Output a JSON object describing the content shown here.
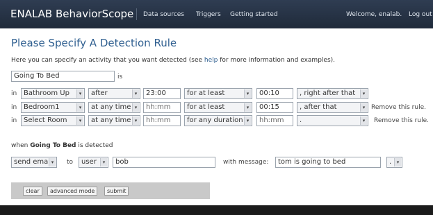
{
  "header": {
    "brand": "ENALAB BehaviorScope",
    "nav": [
      "Data sources",
      "Triggers",
      "Getting started"
    ],
    "welcome": "Welcome, enalab.",
    "logout": "Log out"
  },
  "page": {
    "title": "Please Specify A Detection Rule",
    "intro_before": "Here you can specify an activity that you want detected (see ",
    "intro_link": "help",
    "intro_after": " for more information and examples).",
    "activity_name": "Going To Bed",
    "is_label": "is"
  },
  "rules": [
    {
      "in": "in",
      "room": "Bathroom Up",
      "when": "after",
      "time": "23:00",
      "duration_mode": "for at least",
      "duration": "00:10",
      "connector": ", right after that",
      "remove": ""
    },
    {
      "in": "in",
      "room": "Bedroom1",
      "when": "at any time",
      "time": "hh:mm",
      "duration_mode": "for at least",
      "duration": "00:15",
      "connector": ", after that",
      "remove": "Remove this rule."
    },
    {
      "in": "in",
      "room": "Select Room",
      "when": "at any time",
      "time": "hh:mm",
      "duration_mode": "for any duration",
      "duration": "hh:mm",
      "connector": ".",
      "remove": "Remove this rule."
    }
  ],
  "action": {
    "when_prefix": "when",
    "activity": "Going To Bed",
    "when_suffix": "is detected",
    "method": "send email",
    "to_label": "to",
    "recipient_type": "user",
    "recipient": "bob",
    "message_label": "with message:",
    "message": "tom is going to bed",
    "punctuation": "."
  },
  "buttons": {
    "clear": "clear",
    "advanced": "advanced mode",
    "submit": "submit"
  }
}
